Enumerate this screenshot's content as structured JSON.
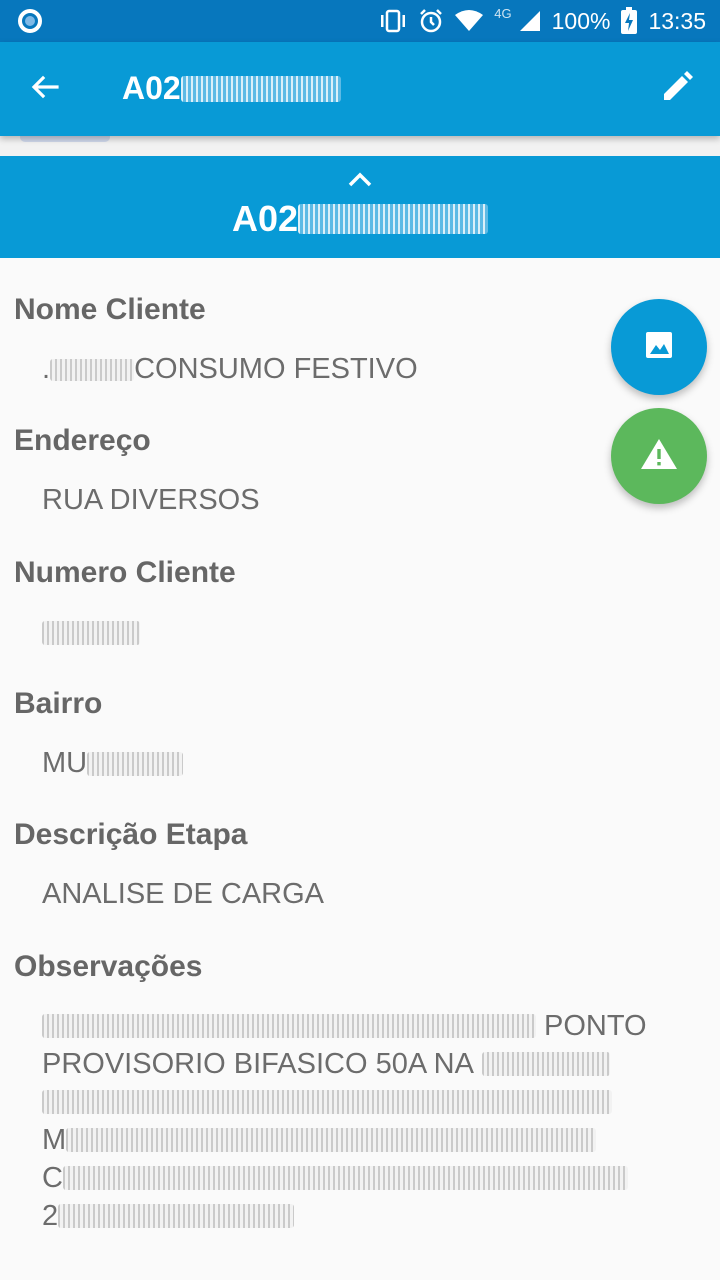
{
  "status_bar": {
    "network_type": "4G",
    "battery": "100%",
    "time": "13:35",
    "icons": [
      "circle-notification-icon",
      "vibrate-icon",
      "alarm-icon",
      "wifi-icon",
      "signal-icon",
      "battery-charging-icon"
    ]
  },
  "app_bar": {
    "title_prefix": "A02",
    "back_icon": "back-arrow-icon",
    "edit_icon": "pencil-icon",
    "color": "#089ad6"
  },
  "section_header": {
    "code_prefix": "A02",
    "chevron_icon": "chevron-up-icon"
  },
  "fields": {
    "nome_cliente": {
      "label": "Nome Cliente",
      "value_prefix": ".",
      "value": "CONSUMO FESTIVO"
    },
    "endereco": {
      "label": "Endereço",
      "value": "RUA DIVERSOS"
    },
    "numero_cliente": {
      "label": "Numero Cliente"
    },
    "bairro": {
      "label": "Bairro",
      "value_prefix": "MU"
    },
    "descricao_etapa": {
      "label": "Descrição Etapa",
      "value": "ANALISE DE CARGA"
    },
    "observacoes": {
      "label": "Observações",
      "line1_suffix": "PONTO",
      "line2": "PROVISORIO BIFASICO 50A NA",
      "line4_prefix": "M",
      "line5_prefix": "C",
      "line6_prefix": "2"
    }
  },
  "fabs": {
    "photo_icon": "image-icon",
    "warning_icon": "warning-icon",
    "photo_color": "#089ad6",
    "warning_color": "#5cb85c"
  }
}
